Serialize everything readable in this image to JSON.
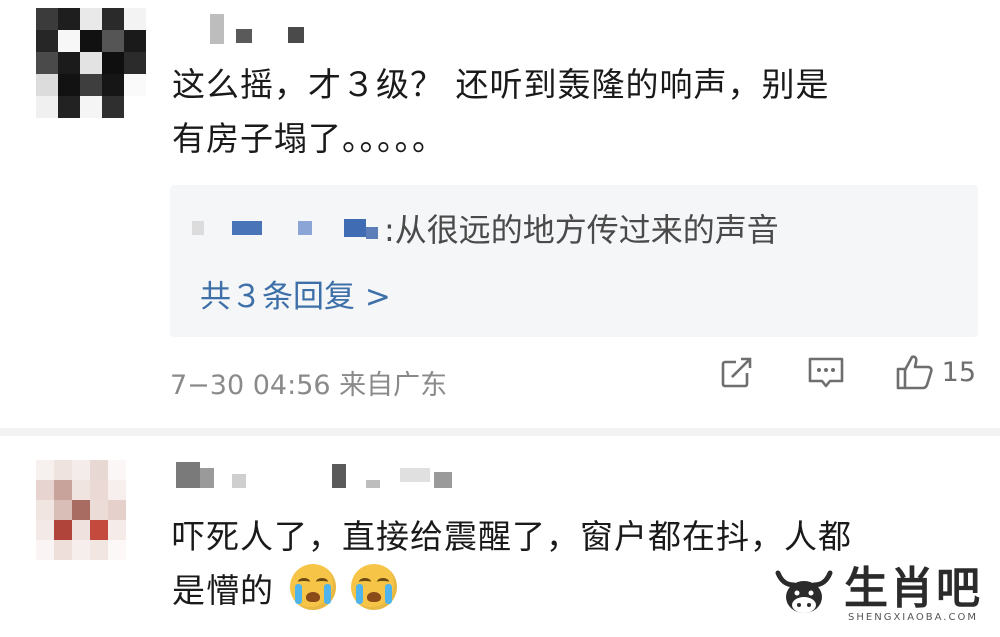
{
  "comments": [
    {
      "text_line1": "这么摇，才３级？ 还听到轰隆的响声，别是",
      "text_line2": "有房子塌了。。。。。",
      "reply": {
        "text": ":从很远的地方传过来的声音",
        "count_label": "共３条回复 >"
      },
      "meta": "7−30 04:56 来自广东",
      "like_count": "15",
      "icons": [
        "share-icon",
        "comment-icon",
        "like-icon"
      ]
    },
    {
      "text_line1": "吓死人了，直接给震醒了，窗户都在抖，人都",
      "text_line2": "是懵的",
      "emojis": [
        "crying-face-icon",
        "crying-face-icon"
      ]
    }
  ],
  "watermark": {
    "text": "生肖吧",
    "sub": "SHENGXIAOBA.COM"
  },
  "colors": {
    "link": "#3d6fa8",
    "meta": "#8a8a8a",
    "reply_bg": "#f5f6f8",
    "mosaic_blue": "#4a74b8"
  }
}
